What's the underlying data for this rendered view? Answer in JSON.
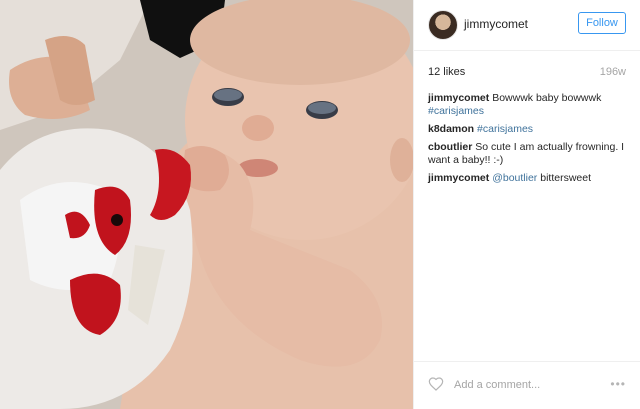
{
  "header": {
    "username": "jimmycomet",
    "follow_label": "Follow"
  },
  "post": {
    "likes": "12 likes",
    "age": "196w"
  },
  "comments": [
    {
      "user": "jimmycomet",
      "text": "Bowwwk baby bowwwk",
      "tag": "#carisjames"
    },
    {
      "user": "k8damon",
      "text": "",
      "tag": "#carisjames"
    },
    {
      "user": "cboutlier",
      "text": "So cute I am actually frowning. I want a baby!! :-)",
      "tag": ""
    },
    {
      "user": "jimmycomet",
      "text": "bittersweet",
      "mention": "@boutlier"
    }
  ],
  "footer": {
    "comment_placeholder": "Add a comment...",
    "heart_icon": "heart-outline-icon",
    "more_icon": "more-horizontal-icon"
  },
  "colors": {
    "accent": "#3897f0",
    "link": "#3f729b",
    "muted": "#a5a5a5"
  }
}
